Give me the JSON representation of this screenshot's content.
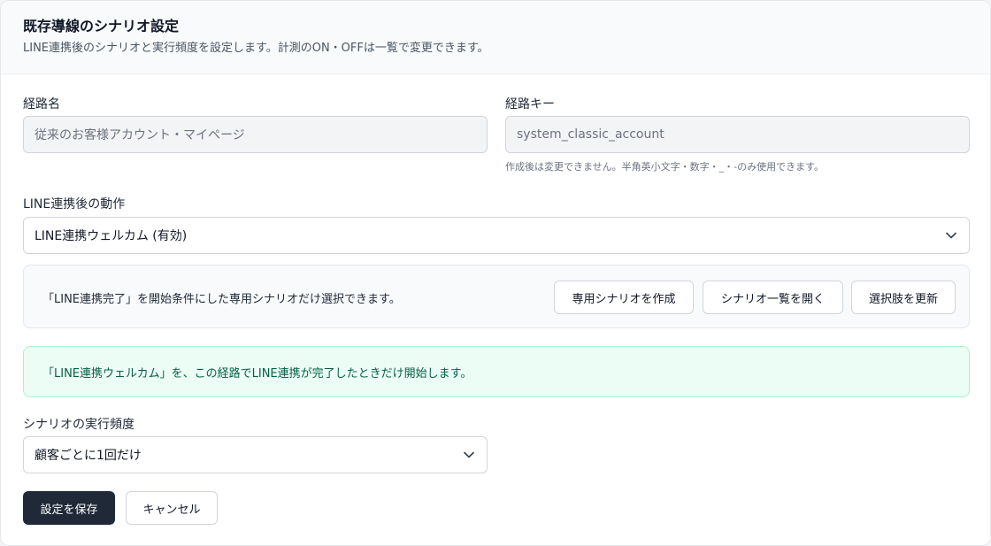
{
  "header": {
    "title": "既存導線のシナリオ設定",
    "subtitle": "LINE連携後のシナリオと実行頻度を設定します。計測のON・OFFは一覧で変更できます。"
  },
  "route_name": {
    "label": "経路名",
    "value": "従来のお客様アカウント・マイページ"
  },
  "route_key": {
    "label": "経路キー",
    "value": "system_classic_account",
    "hint": "作成後は変更できません。半角英小文字・数字・_・-のみ使用できます。"
  },
  "action": {
    "label": "LINE連携後の動作",
    "selected": "LINE連携ウェルカム (有効)"
  },
  "scenario_info": {
    "text": "「LINE連携完了」を開始条件にした専用シナリオだけ選択できます。",
    "create_button": "専用シナリオを作成",
    "open_list_button": "シナリオ一覧を開く",
    "refresh_button": "選択肢を更新"
  },
  "success_message": "「LINE連携ウェルカム」を、この経路でLINE連携が完了したときだけ開始します。",
  "frequency": {
    "label": "シナリオの実行頻度",
    "selected": "顧客ごとに1回だけ"
  },
  "footer": {
    "save_button": "設定を保存",
    "cancel_button": "キャンセル"
  },
  "icons": {
    "select_chevron": "chevron-down-icon"
  },
  "colors": {
    "primary_button": "#1f2937",
    "success_bg": "#ecfdf5",
    "success_border": "#a7f3d0",
    "success_text": "#065f46"
  }
}
